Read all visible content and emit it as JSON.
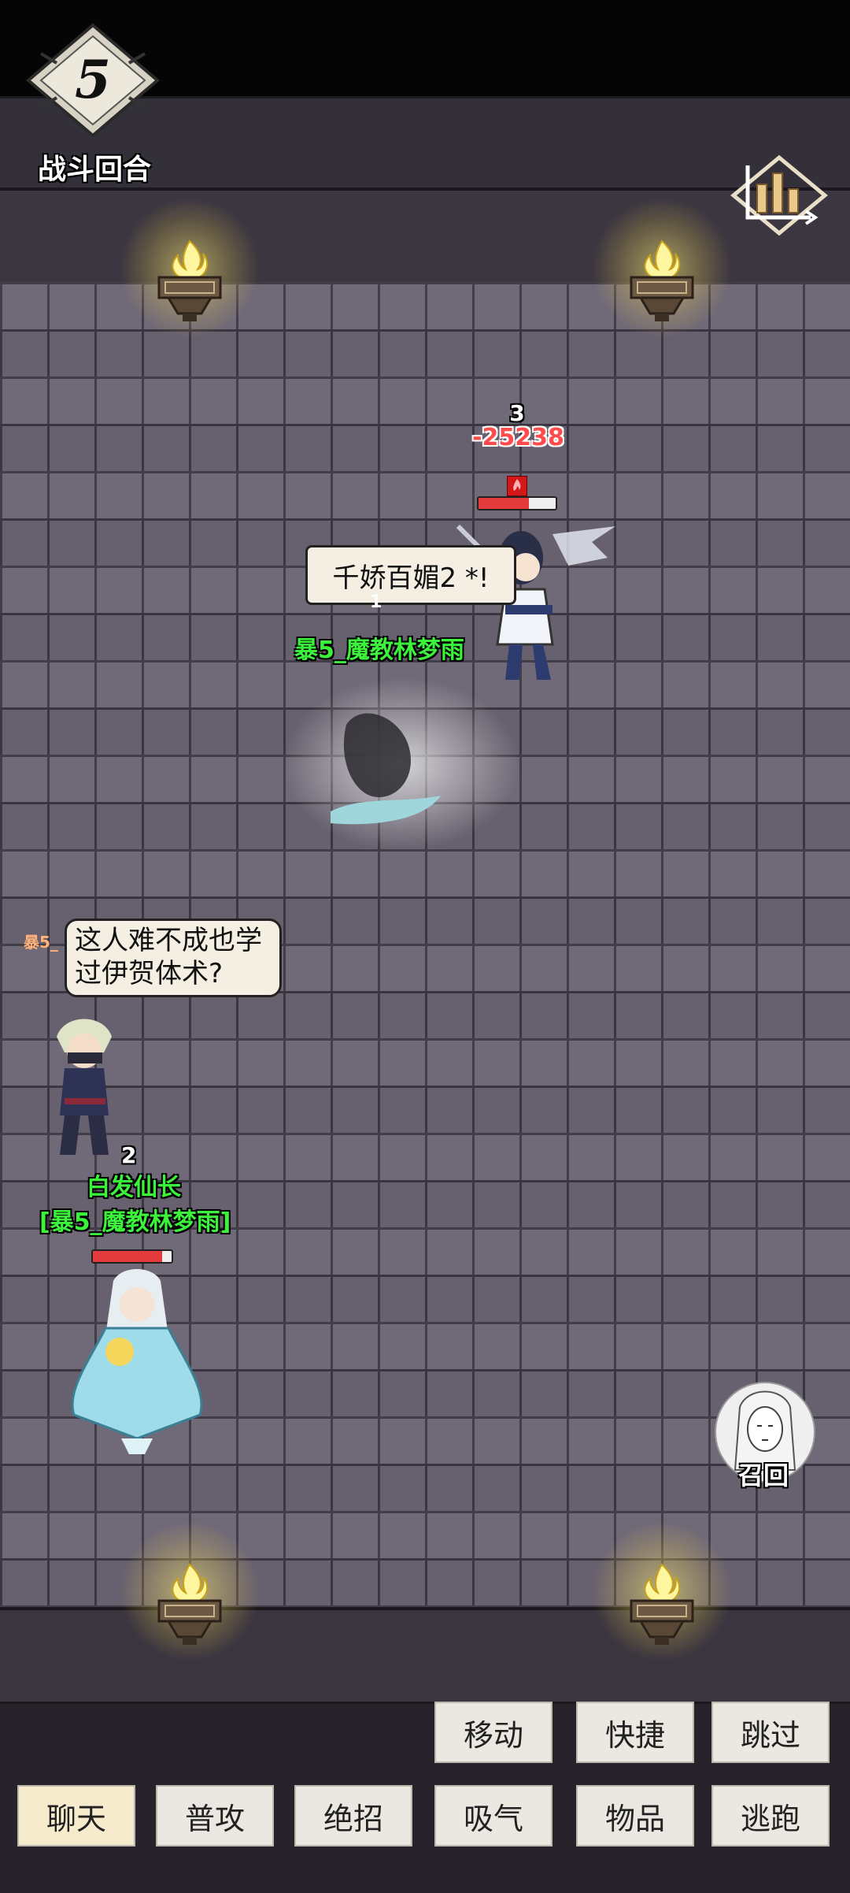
{
  "round": {
    "number": "5",
    "label": "战斗回合"
  },
  "enemy": {
    "position_number": "3",
    "damage": "-25238",
    "hp_fraction": 0.65,
    "skill_text": "千娇百媚2 *!",
    "small_number": "1",
    "name": "暴5_魔教林梦雨"
  },
  "ally_ninja": {
    "tag": "暴5_",
    "speech": "这人难不成也学过伊贺体术?",
    "position_number": "2",
    "name": "白发仙长",
    "target_name": "[暴5_魔教林梦雨]"
  },
  "ally_player": {
    "hp_fraction": 0.88
  },
  "recall": {
    "label": "召回"
  },
  "buttons_row1": [
    {
      "label": "移动"
    },
    {
      "label": "快捷"
    },
    {
      "label": "跳过"
    }
  ],
  "buttons_row2": [
    {
      "label": "聊天"
    },
    {
      "label": "普攻"
    },
    {
      "label": "绝招"
    },
    {
      "label": "吸气"
    },
    {
      "label": "物品"
    },
    {
      "label": "逃跑"
    }
  ],
  "colors": {
    "name_green": "#3cf33c",
    "damage_red": "#ff4b4b",
    "hp_red": "#e33b3b"
  }
}
